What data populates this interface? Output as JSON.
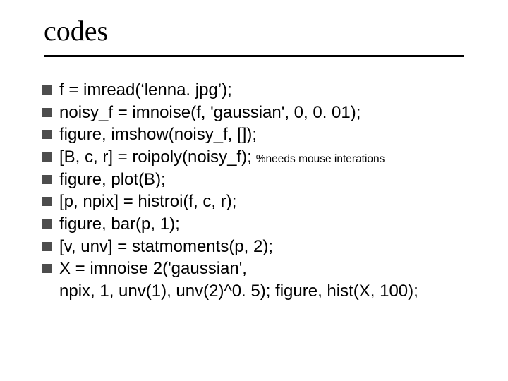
{
  "title": "codes",
  "lines": {
    "l1": "f = imread(‘lenna. jpg’);",
    "l2": "noisy_f = imnoise(f, 'gaussian', 0, 0. 01);",
    "l3": "figure, imshow(noisy_f, []);",
    "l4": "[B, c, r] = roipoly(noisy_f);",
    "l4_comment": "%needs mouse interations",
    "l5": "figure, plot(B);",
    "l6": "[p, npix] = histroi(f, c, r);",
    "l7": "figure, bar(p, 1);",
    "l8": "[v, unv] = statmoments(p, 2);",
    "l9": "X = imnoise 2('gaussian',",
    "l9_cont": "npix, 1, unv(1), unv(2)^0. 5); figure, hist(X, 100);"
  }
}
